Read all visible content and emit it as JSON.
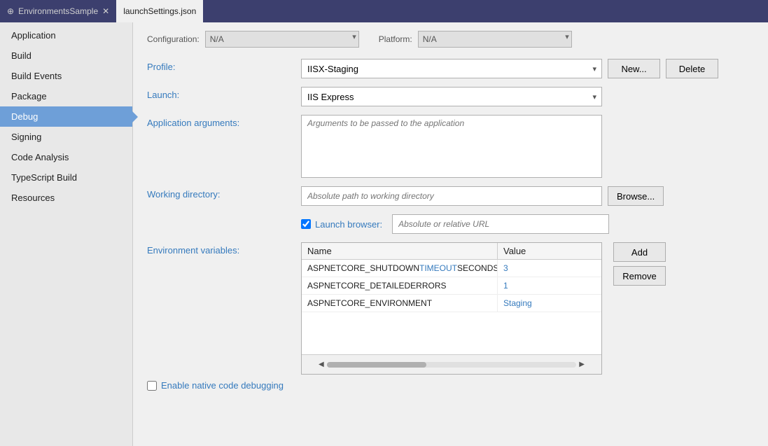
{
  "titleBar": {
    "tabs": [
      {
        "label": "EnvironmentsSample",
        "pin": "⊕",
        "close": "✕",
        "active": false
      },
      {
        "label": "launchSettings.json",
        "active": true
      }
    ]
  },
  "sidebar": {
    "items": [
      {
        "label": "Application",
        "active": false
      },
      {
        "label": "Build",
        "active": false
      },
      {
        "label": "Build Events",
        "active": false
      },
      {
        "label": "Package",
        "active": false
      },
      {
        "label": "Debug",
        "active": true
      },
      {
        "label": "Signing",
        "active": false
      },
      {
        "label": "Code Analysis",
        "active": false
      },
      {
        "label": "TypeScript Build",
        "active": false
      },
      {
        "label": "Resources",
        "active": false
      }
    ]
  },
  "content": {
    "configuration": {
      "label": "Configuration:",
      "value": "N/A"
    },
    "platform": {
      "label": "Platform:",
      "value": "N/A"
    },
    "profile": {
      "label": "Profile:",
      "value": "IISX-Staging",
      "button_new": "New...",
      "button_delete": "Delete"
    },
    "launch": {
      "label": "Launch:",
      "value": "IIS Express"
    },
    "application_arguments": {
      "label": "Application arguments:",
      "placeholder": "Arguments to be passed to the application"
    },
    "working_directory": {
      "label": "Working directory:",
      "placeholder": "Absolute path to working directory",
      "button_browse": "Browse..."
    },
    "launch_browser": {
      "label": "Launch browser:",
      "checked": true,
      "placeholder": "Absolute or relative URL"
    },
    "environment_variables": {
      "label": "Environment variables:",
      "columns": [
        "Name",
        "Value"
      ],
      "rows": [
        {
          "name": "ASPNETCORE_SHUTDOWNTIMEOUTSECONDS",
          "highlight": "TIMEOUT",
          "value": "3",
          "value_color": true
        },
        {
          "name": "ASPNETCORE_DETAILEDERRORS",
          "highlight": "DETAILEDERRORS",
          "value": "1",
          "value_color": true
        },
        {
          "name": "ASPNETCORE_ENVIRONMENT",
          "highlight": "ENVIRONMENT",
          "value": "Staging",
          "value_color": true
        }
      ],
      "button_add": "Add",
      "button_remove": "Remove"
    },
    "enable_native": {
      "label": "Enable native code debugging",
      "checked": false
    }
  }
}
